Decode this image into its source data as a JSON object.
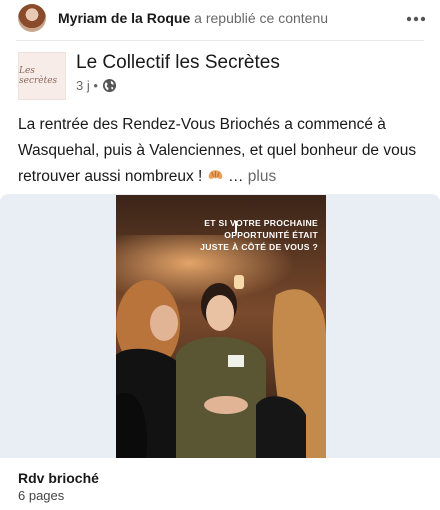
{
  "repost": {
    "name": "Myriam de la Roque",
    "action": "a republié ce contenu"
  },
  "post": {
    "company_name": "Le Collectif les Secrètes",
    "logo_text": "Les secrètes",
    "time": "3 j •",
    "text": "La rentrée des Rendez-Vous Briochés a commencé à Wasquehal, puis à Valenciennes, et quel bonheur de vous retrouver aussi nombreux !",
    "ellipsis": "…",
    "more_label": "plus"
  },
  "media": {
    "overlay_text": "ET SI VOTRE PROCHAINE OPPORTUNITÉ ÉTAIT JUSTE À CÔTÉ DE VOUS ?"
  },
  "document": {
    "title": "Rdv brioché",
    "pages": "6 pages"
  },
  "icons": {
    "more": "more-horizontal-icon",
    "visibility": "globe-icon",
    "emoji": "croissant-emoji-icon"
  },
  "colors": {
    "media_background": "#e9eef4",
    "secondary_text": "#666666"
  }
}
